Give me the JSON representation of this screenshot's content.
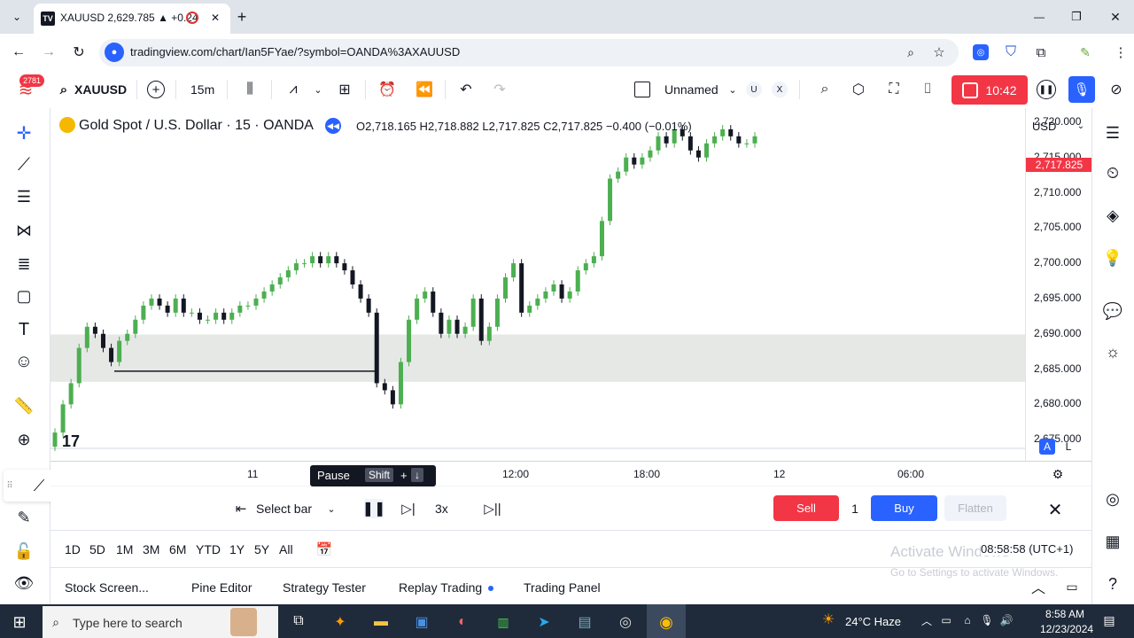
{
  "browser": {
    "tab_title": "XAUUSD 2,629.785 ▲ +0.24",
    "new_tab": "+",
    "url": "tradingview.com/chart/Ian5FYae/?symbol=OANDA%3AXAUUSD",
    "minimize": "—",
    "maximize": "❐",
    "close": "✕"
  },
  "toolbar": {
    "notif_count": "2781",
    "symbol": "XAUUSD",
    "interval": "15m",
    "layout_name": "Unnamed",
    "u_label": "U",
    "x_label": "X",
    "record_time": "10:42"
  },
  "legend": {
    "title": "Gold Spot / U.S. Dollar · 15 · OANDA",
    "ohlc": "O2,718.165 H2,718.882 L2,717.825 C2,717.825 −0.400 (−0.01%)"
  },
  "price_axis": {
    "currency": "USD",
    "current_price": "2,717.825",
    "ticks": [
      "2,720.000",
      "2,715.000",
      "2,710.000",
      "2,705.000",
      "2,700.000",
      "2,695.000",
      "2,690.000",
      "2,685.000",
      "2,680.000",
      "2,675.000"
    ],
    "auto": "A",
    "log": "L"
  },
  "time_axis": {
    "ticks": [
      "11",
      "12:00",
      "18:00",
      "12",
      "06:00"
    ]
  },
  "replay": {
    "select_bar": "Select bar",
    "speed": "3x",
    "tooltip_pause": "Pause",
    "tooltip_shift": "Shift",
    "tooltip_plus": "+",
    "tooltip_arrow": "↓",
    "sell": "Sell",
    "qty": "1",
    "buy": "Buy",
    "flatten": "Flatten"
  },
  "ranges": {
    "items": [
      "1D",
      "5D",
      "1M",
      "3M",
      "6M",
      "YTD",
      "1Y",
      "5Y",
      "All"
    ],
    "clock": "08:58:58 (UTC+1)",
    "watermark1": "Activate Windows",
    "watermark2": "Go to Settings to activate Windows."
  },
  "bottom_tabs": {
    "items": [
      "Stock Screen...",
      "Pine Editor",
      "Strategy Tester",
      "Replay Trading",
      "Trading Panel"
    ]
  },
  "taskbar": {
    "search": "Type here to search",
    "weather": "24°C  Haze",
    "time": "8:58 AM",
    "date": "12/23/2024"
  },
  "colors": {
    "up": "#4caf50",
    "down": "#131722",
    "accent": "#2962ff",
    "sell": "#f23645",
    "zone": "#e6e8e6"
  },
  "chart_data": {
    "type": "candlestick",
    "symbol": "XAUUSD",
    "ylim": [
      2672,
      2722
    ],
    "current": 2717.825,
    "zone": [
      2683.2,
      2689.9
    ],
    "hline": 2684.7,
    "closes": [
      2676,
      2680,
      2683,
      2688,
      2691,
      2690,
      2688,
      2686,
      2689,
      2690,
      2692,
      2694,
      2695,
      2694,
      2693,
      2695,
      2693,
      2693,
      2692,
      2692,
      2693,
      2692,
      2693,
      2694,
      2694,
      2695,
      2696,
      2697,
      2698,
      2699,
      2700,
      2700,
      2701,
      2700,
      2701,
      2700,
      2699,
      2697,
      2695,
      2693,
      2683,
      2682,
      2680,
      2686,
      2692,
      2695,
      2696,
      2693,
      2690,
      2692,
      2690,
      2691,
      2695,
      2689,
      2691,
      2695,
      2698,
      2700,
      2693,
      2694,
      2695,
      2696,
      2697,
      2695,
      2696,
      2699,
      2700,
      2701,
      2706,
      2712,
      2713,
      2715,
      2714,
      2715,
      2716,
      2718,
      2717,
      2719,
      2718,
      2716,
      2715,
      2717,
      2718,
      2719,
      2718,
      2717,
      2717,
      2718
    ]
  }
}
